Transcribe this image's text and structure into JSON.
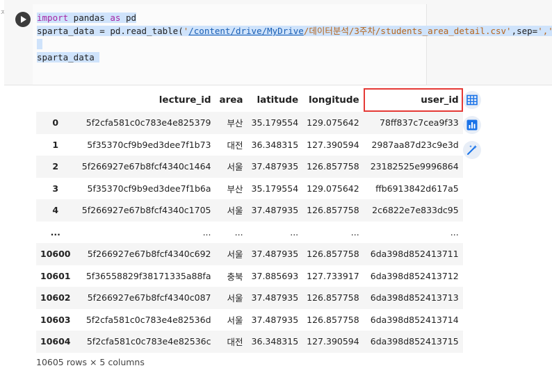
{
  "side_glyph": "ㅈ",
  "code_cell": {
    "lines": [
      {
        "segments": [
          {
            "text": "import",
            "cls": "kw"
          },
          {
            "text": " pandas ",
            "cls": ""
          },
          {
            "text": "as",
            "cls": "kw"
          },
          {
            "text": " pd",
            "cls": ""
          }
        ]
      },
      {
        "segments": [
          {
            "text": "sparta_data = pd.read_table(",
            "cls": ""
          },
          {
            "text": "'",
            "cls": "str"
          },
          {
            "text": "/content/drive/MyDrive",
            "cls": "path"
          },
          {
            "text": "/데이터분석/3주차/students_area_detail.csv'",
            "cls": "str"
          },
          {
            "text": ",sep=",
            "cls": ""
          },
          {
            "text": "','",
            "cls": "str"
          },
          {
            "text": ")",
            "cls": ""
          }
        ]
      },
      {
        "segments": [
          {
            "text": " ",
            "cls": ""
          }
        ]
      },
      {
        "segments": [
          {
            "text": "sparta_data ",
            "cls": ""
          }
        ]
      }
    ]
  },
  "dataframe": {
    "columns": [
      "",
      "lecture_id",
      "area",
      "latitude",
      "longitude",
      "user_id"
    ],
    "highlighted_column": "user_id",
    "rows": [
      {
        "index": "0",
        "cells": [
          "5f2cfa581c0c783e4e825379",
          "부산",
          "35.179554",
          "129.075642",
          "78ff837c7cea9f33"
        ]
      },
      {
        "index": "1",
        "cells": [
          "5f35370cf9b9ed3dee7f1b73",
          "대전",
          "36.348315",
          "127.390594",
          "2987aa87d23c9e3d"
        ]
      },
      {
        "index": "2",
        "cells": [
          "5f266927e67b8fcf4340c1464",
          "서울",
          "37.487935",
          "126.857758",
          "23182525e9996864"
        ]
      },
      {
        "index": "3",
        "cells": [
          "5f35370cf9b9ed3dee7f1b6a",
          "부산",
          "35.179554",
          "129.075642",
          "ffb6913842d617a5"
        ]
      },
      {
        "index": "4",
        "cells": [
          "5f266927e67b8fcf4340c1705",
          "서울",
          "37.487935",
          "126.857758",
          "2c6822e7e833dc95"
        ]
      },
      {
        "index": "...",
        "cells": [
          "...",
          "...",
          "...",
          "...",
          "..."
        ]
      },
      {
        "index": "10600",
        "cells": [
          "5f266927e67b8fcf4340c692",
          "서울",
          "37.487935",
          "126.857758",
          "6da398d852413711"
        ]
      },
      {
        "index": "10601",
        "cells": [
          "5f36558829f38171335a88fa",
          "충북",
          "37.885693",
          "127.733917",
          "6da398d852413712"
        ]
      },
      {
        "index": "10602",
        "cells": [
          "5f266927e67b8fcf4340c087",
          "서울",
          "37.487935",
          "126.857758",
          "6da398d852413713"
        ]
      },
      {
        "index": "10603",
        "cells": [
          "5f2cfa581c0c783e4e82536d",
          "서울",
          "37.487935",
          "126.857758",
          "6da398d852413714"
        ]
      },
      {
        "index": "10604",
        "cells": [
          "5f2cfa581c0c783e4e82536c",
          "대전",
          "36.348315",
          "127.390594",
          "6da398d852413715"
        ]
      }
    ],
    "summary": "10605 rows × 5 columns"
  },
  "toolbar": [
    {
      "name": "table-icon",
      "kind": "table"
    },
    {
      "name": "chart-icon",
      "kind": "chart"
    },
    {
      "name": "magic-wand-icon",
      "kind": "wand"
    }
  ],
  "colors": {
    "highlight": "#e53935",
    "keyword": "#a626a4",
    "string": "#b5651d",
    "path": "#1a5fb4",
    "selection": "#cfe3fb",
    "icon": "#1a73e8"
  }
}
